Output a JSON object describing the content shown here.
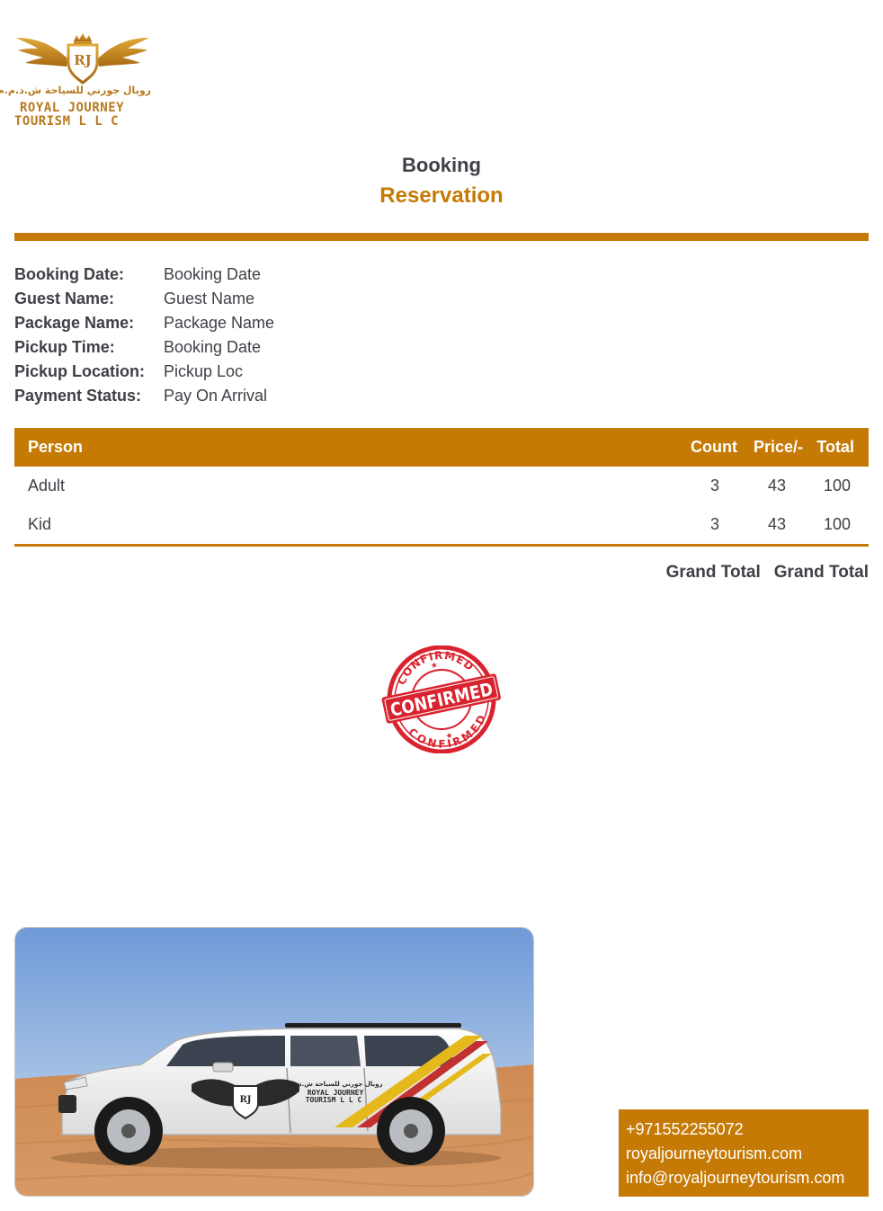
{
  "logo": {
    "monogram": "RJ",
    "arabic": "رويال جورني للسياحة ش.ذ.م.م",
    "line1": "ROYAL JOURNEY",
    "line2": "TOURISM L L C"
  },
  "header": {
    "title": "Booking",
    "subtitle": "Reservation"
  },
  "details": [
    {
      "label": "Booking Date:",
      "value": "Booking Date"
    },
    {
      "label": "Guest Name:",
      "value": "Guest Name"
    },
    {
      "label": "Package Name:",
      "value": "Package Name"
    },
    {
      "label": "Pickup Time:",
      "value": "Booking Date"
    },
    {
      "label": "Pickup Location:",
      "value": "Pickup Loc"
    },
    {
      "label": "Payment Status:",
      "value": "Pay On Arrival"
    }
  ],
  "table": {
    "headers": {
      "person": "Person",
      "count": "Count",
      "price": "Price/-",
      "total": "Total"
    },
    "rows": [
      {
        "person": "Adult",
        "count": "3",
        "price": "43",
        "total": "100"
      },
      {
        "person": "Kid",
        "count": "3",
        "price": "43",
        "total": "100"
      }
    ]
  },
  "grand_total": {
    "label": "Grand Total",
    "value": "Grand Total"
  },
  "stamp": {
    "top": "CONFIRMED",
    "center": "CONFIRMED",
    "bottom": "CONFIRMED"
  },
  "vehicle_photo": {
    "door_arabic": "رويال جورني للسياحة ش.ذ.م.م",
    "door_line1": "ROYAL JOURNEY",
    "door_line2": "TOURISM L L C",
    "monogram": "RJ"
  },
  "contact": {
    "phone": "+971552255072",
    "website": "royaljourneytourism.com",
    "email": "info@royaljourneytourism.com"
  },
  "colors": {
    "accent": "#c57a05",
    "text": "#3f3f46",
    "stamp": "#d9232e",
    "logo_gold": "#b7791f"
  }
}
